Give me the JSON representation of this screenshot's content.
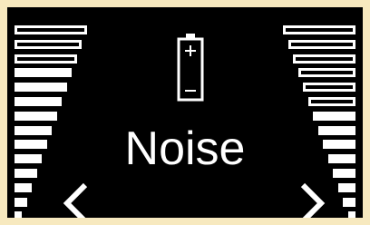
{
  "device": {
    "mode_label": "Noise",
    "accent_color": "#ffffff",
    "background_color": "#000000",
    "frame_color": "#f7e9bf"
  },
  "left_meter": {
    "segments_total": 14,
    "hollow_segments": 3,
    "filled_segments": 11,
    "icon": "level-bars"
  },
  "right_meter": {
    "segments_total": 14,
    "hollow_segments": 6,
    "filled_segments": 8,
    "icon": "level-bars"
  },
  "battery": {
    "icon": "battery-icon",
    "level": 0
  },
  "navigation": {
    "previous_icon": "chevron-left-icon",
    "next_icon": "chevron-right-icon"
  }
}
